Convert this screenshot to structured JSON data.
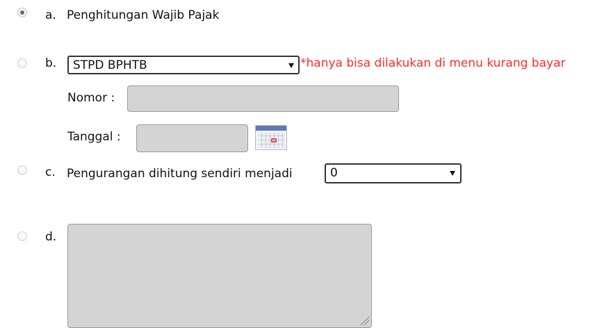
{
  "options": {
    "a": {
      "letter": "a.",
      "label": "Penghitungan Wajib Pajak",
      "checked": true
    },
    "b": {
      "letter": "b.",
      "select_value": "STPD BPHTB",
      "hint": "*hanya bisa dilakukan di menu kurang bayar",
      "nomor_label": "Nomor :",
      "tanggal_label": "Tanggal :",
      "checked": false
    },
    "c": {
      "letter": "c.",
      "label": "Pengurangan dihitung sendiri menjadi",
      "select_value": "0",
      "checked": false
    },
    "d": {
      "letter": "d.",
      "checked": false
    }
  },
  "icons": {
    "calendar": "calendar-icon",
    "dropdown": "chevron-down-icon"
  },
  "colors": {
    "hint": "#ff2a2a",
    "disabled_field": "#d4d4d4"
  }
}
